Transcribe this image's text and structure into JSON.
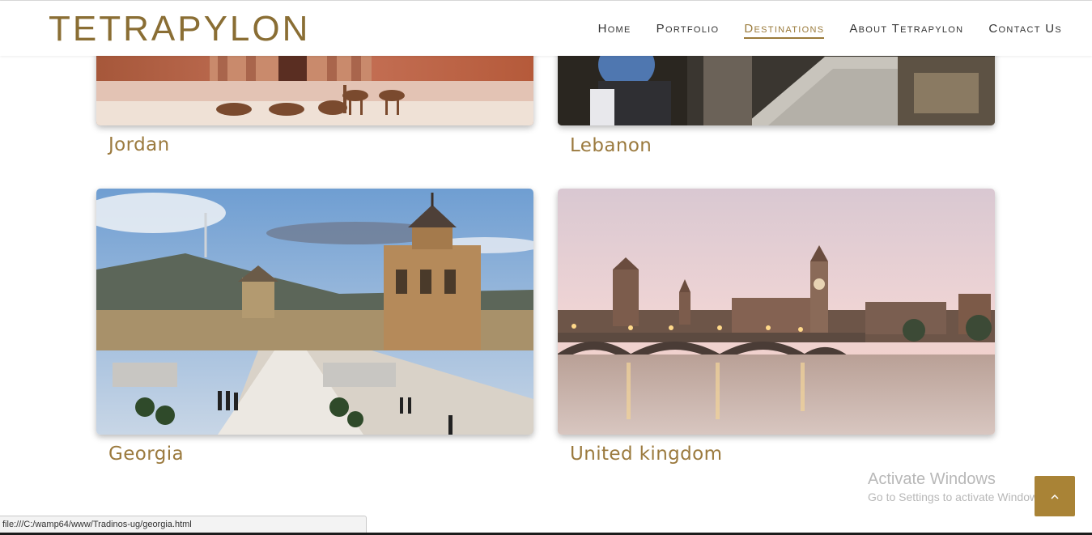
{
  "brand": {
    "logo_text": "TETRAPYLON",
    "accent_color": "#9b7a3e"
  },
  "nav": {
    "items": [
      {
        "label": "Home"
      },
      {
        "label": "Portfolio"
      },
      {
        "label": "Destinations"
      },
      {
        "label": "About Tetrapylon"
      },
      {
        "label": "Contact Us"
      }
    ],
    "active_item": "Destinations"
  },
  "destinations": [
    {
      "name": "Jordan",
      "image": "petra-treasury-camels"
    },
    {
      "name": "Lebanon",
      "image": "souk-street-vendor"
    },
    {
      "name": "Georgia",
      "image": "tbilisi-sameba-cathedral"
    },
    {
      "name": "United kingdom",
      "image": "westminster-big-ben-sunset"
    }
  ],
  "watermark": {
    "line1": "Activate Windows",
    "line2": "Go to Settings to activate Windows."
  },
  "scroll_top": {
    "icon": "chevron-up-icon"
  },
  "status_bar": {
    "url": "file:///C:/wamp64/www/Tradinos-ug/georgia.html"
  }
}
